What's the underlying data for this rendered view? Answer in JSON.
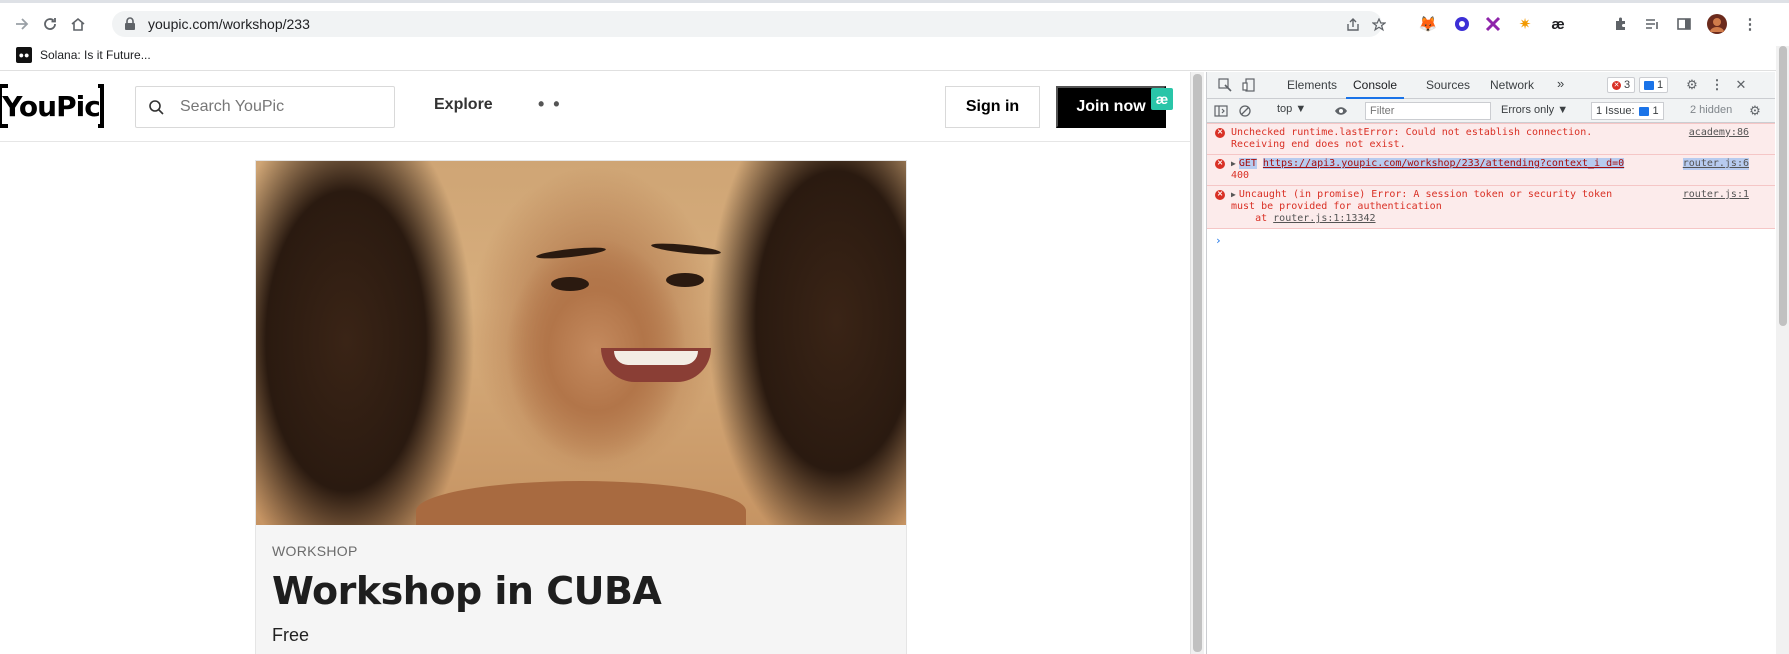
{
  "browser": {
    "url": "youpic.com/workshop/233",
    "bookmark_label": "Solana: Is it Future...",
    "ext_ae": "æ"
  },
  "site": {
    "logo_text": "YouPic",
    "search_placeholder": "Search YouPic",
    "explore_label": "Explore",
    "more_label": "• •",
    "signin_label": "Sign in",
    "join_label": "Join now",
    "badge_label": "æ"
  },
  "workshop": {
    "tag": "WORKSHOP",
    "title": "Workshop in CUBA",
    "price": "Free"
  },
  "devtools": {
    "tabs": [
      "Elements",
      "Console",
      "Sources",
      "Network"
    ],
    "more_tabs": "»",
    "error_count": "3",
    "info_count": "1",
    "context": "top ▼",
    "filter_placeholder": "Filter",
    "levels": "Errors only ▼",
    "issues_label": "1 Issue:",
    "issues_count": "1",
    "hidden": "2 hidden",
    "messages": [
      {
        "text": "Unchecked runtime.lastError: Could not establish connection.\nReceiving end does not exist.",
        "source": "academy:86"
      },
      {
        "method": "GET",
        "url": "https://api3.youpic.com/workshop/233/attending?context_i d=0",
        "status": "400",
        "source": "router.js:6"
      },
      {
        "text": "Uncaught (in promise) Error: A session token or security token\nmust be provided for authentication",
        "stack_prefix": "    at ",
        "stack_link": "router.js:1:13342",
        "source": "router.js:1"
      }
    ],
    "prompt": "›"
  }
}
